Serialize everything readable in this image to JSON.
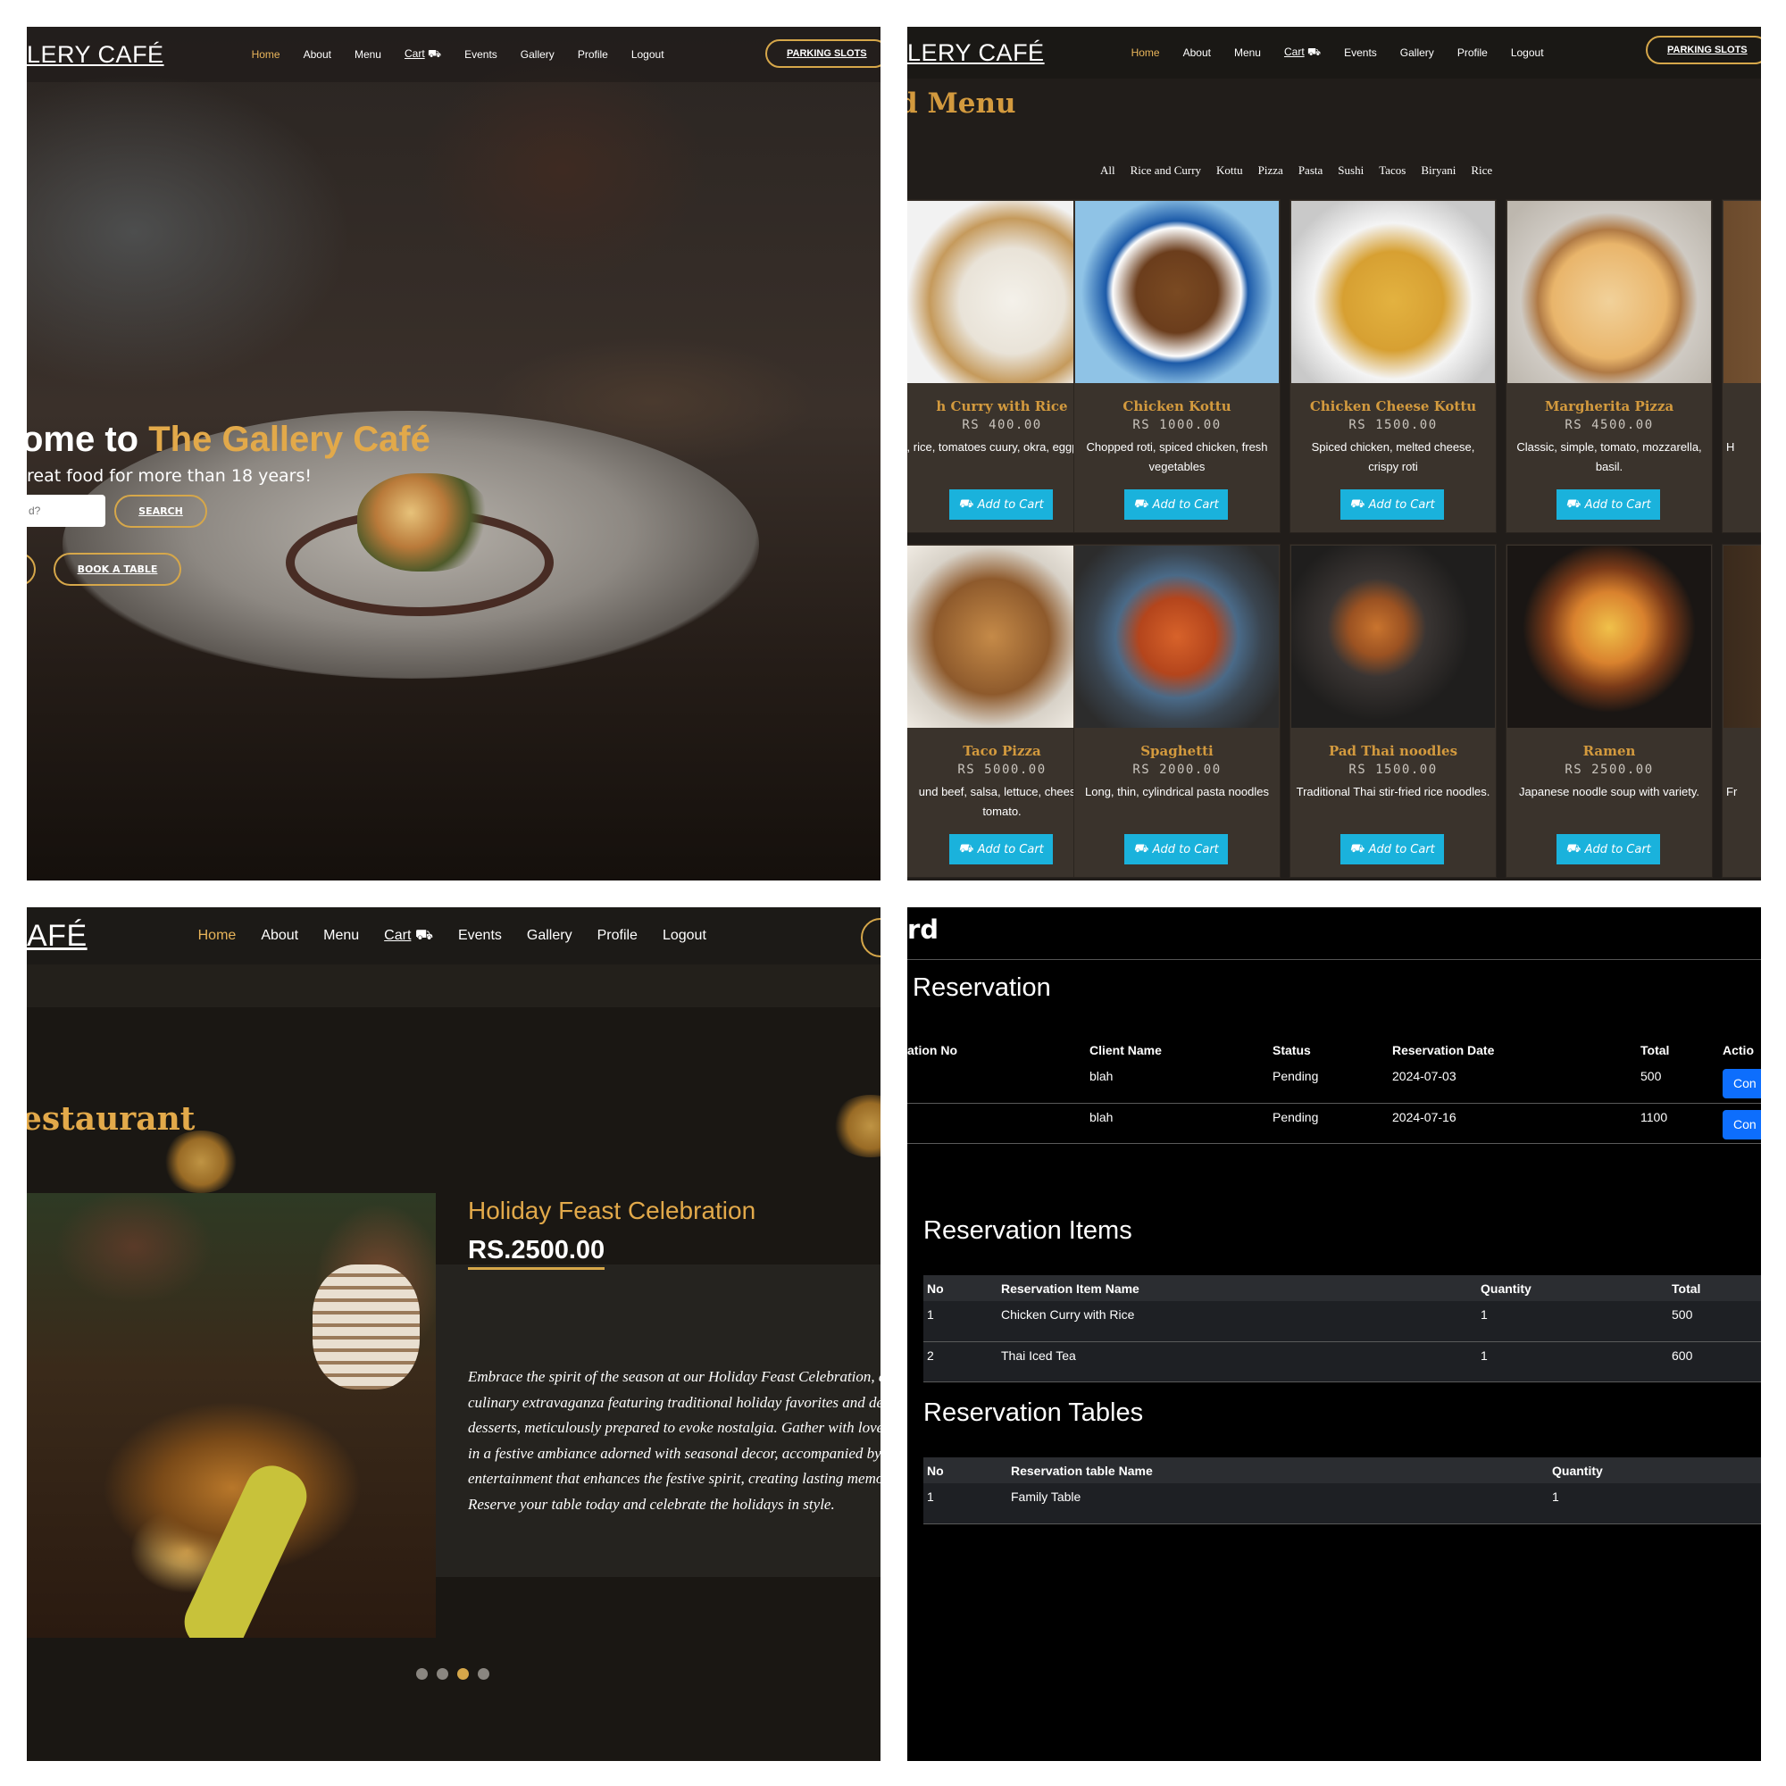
{
  "nav": {
    "brand_full": "LERY CAFÉ",
    "brand_short": "AFÉ",
    "links": [
      "Home",
      "About",
      "Menu",
      "Cart",
      "Events",
      "Gallery",
      "Profile",
      "Logout"
    ],
    "cart_icon": "cart-icon",
    "parking": "PARKING SLOTS"
  },
  "hero": {
    "title_plain": "ome to ",
    "title_gold": "The Gallery Café",
    "subtitle": "reat food for more than 18 years!",
    "search_placeholder": "d?",
    "search_button": "SEARCH",
    "book_button": "BOOK A TABLE"
  },
  "menu": {
    "title": "d Menu",
    "filters": [
      "All",
      "Rice and Curry",
      "Kottu",
      "Pizza",
      "Pasta",
      "Sushi",
      "Tacos",
      "Biryani",
      "Rice"
    ],
    "add_label": "Add to Cart",
    "items": [
      {
        "name": "h Curry with Rice",
        "price": "RS 400.00",
        "desc": ", rice, tomatoes cuury, okra, eggplant"
      },
      {
        "name": "Chicken Kottu",
        "price": "RS 1000.00",
        "desc": "Chopped roti, spiced chicken, fresh vegetables"
      },
      {
        "name": "Chicken Cheese Kottu",
        "price": "RS 1500.00",
        "desc": "Spiced chicken, melted cheese, crispy roti"
      },
      {
        "name": "Margherita Pizza",
        "price": "RS 4500.00",
        "desc": "Classic, simple, tomato, mozzarella, basil."
      },
      {
        "name": "Taco Pizza",
        "price": "RS 5000.00",
        "desc": "und beef, salsa, lettuce, cheese, tomato."
      },
      {
        "name": "Spaghetti",
        "price": "RS 2000.00",
        "desc": "Long, thin, cylindrical pasta noodles"
      },
      {
        "name": "Pad Thai noodles",
        "price": "RS 1500.00",
        "desc": "Traditional Thai stir-fried rice noodles."
      },
      {
        "name": "Ramen",
        "price": "RS 2500.00",
        "desc": "Japanese noodle soup with variety."
      }
    ],
    "partial_right_top": "H",
    "partial_right_bottom": "Fr"
  },
  "events": {
    "title": "estaurant",
    "heading": "Holiday Feast Celebration",
    "price": "RS.2500.00",
    "body": "Embrace the spirit of the season at our Holiday Feast Celebration, a grand culinary extravaganza featuring traditional holiday favorites and decadent desserts, meticulously prepared to evoke nostalgia. Gather with loved ones in a festive ambiance adorned with seasonal decor, accompanied by live entertainment that enhances the festive spirit, creating lasting memories. Reserve your table today and celebrate the holidays in style.",
    "slide_active": 3,
    "slide_count": 4
  },
  "dashboard": {
    "title": "rd",
    "reservation": {
      "title": "Reservation",
      "headers": [
        "ation No",
        "Client Name",
        "Status",
        "Reservation Date",
        "Total",
        "Actio"
      ],
      "rows": [
        {
          "client": "blah",
          "status": "Pending",
          "date": "2024-07-03",
          "total": "500",
          "action": "Con"
        },
        {
          "client": "blah",
          "status": "Pending",
          "date": "2024-07-16",
          "total": "1100",
          "action": "Con"
        }
      ]
    },
    "items": {
      "title": "Reservation Items",
      "headers": [
        "No",
        "Reservation Item Name",
        "Quantity",
        "Total"
      ],
      "rows": [
        {
          "no": "1",
          "name": "Chicken Curry with Rice",
          "qty": "1",
          "total": "500"
        },
        {
          "no": "2",
          "name": "Thai Iced Tea",
          "qty": "1",
          "total": "600"
        }
      ]
    },
    "tables": {
      "title": "Reservation Tables",
      "headers": [
        "No",
        "Reservation table Name",
        "Quantity"
      ],
      "rows": [
        {
          "no": "1",
          "name": "Family Table",
          "qty": "1"
        }
      ]
    }
  },
  "colors": {
    "gold": "#d39a3e",
    "cyan_button": "#1ab2dc",
    "blue_button": "#0d6efd"
  }
}
